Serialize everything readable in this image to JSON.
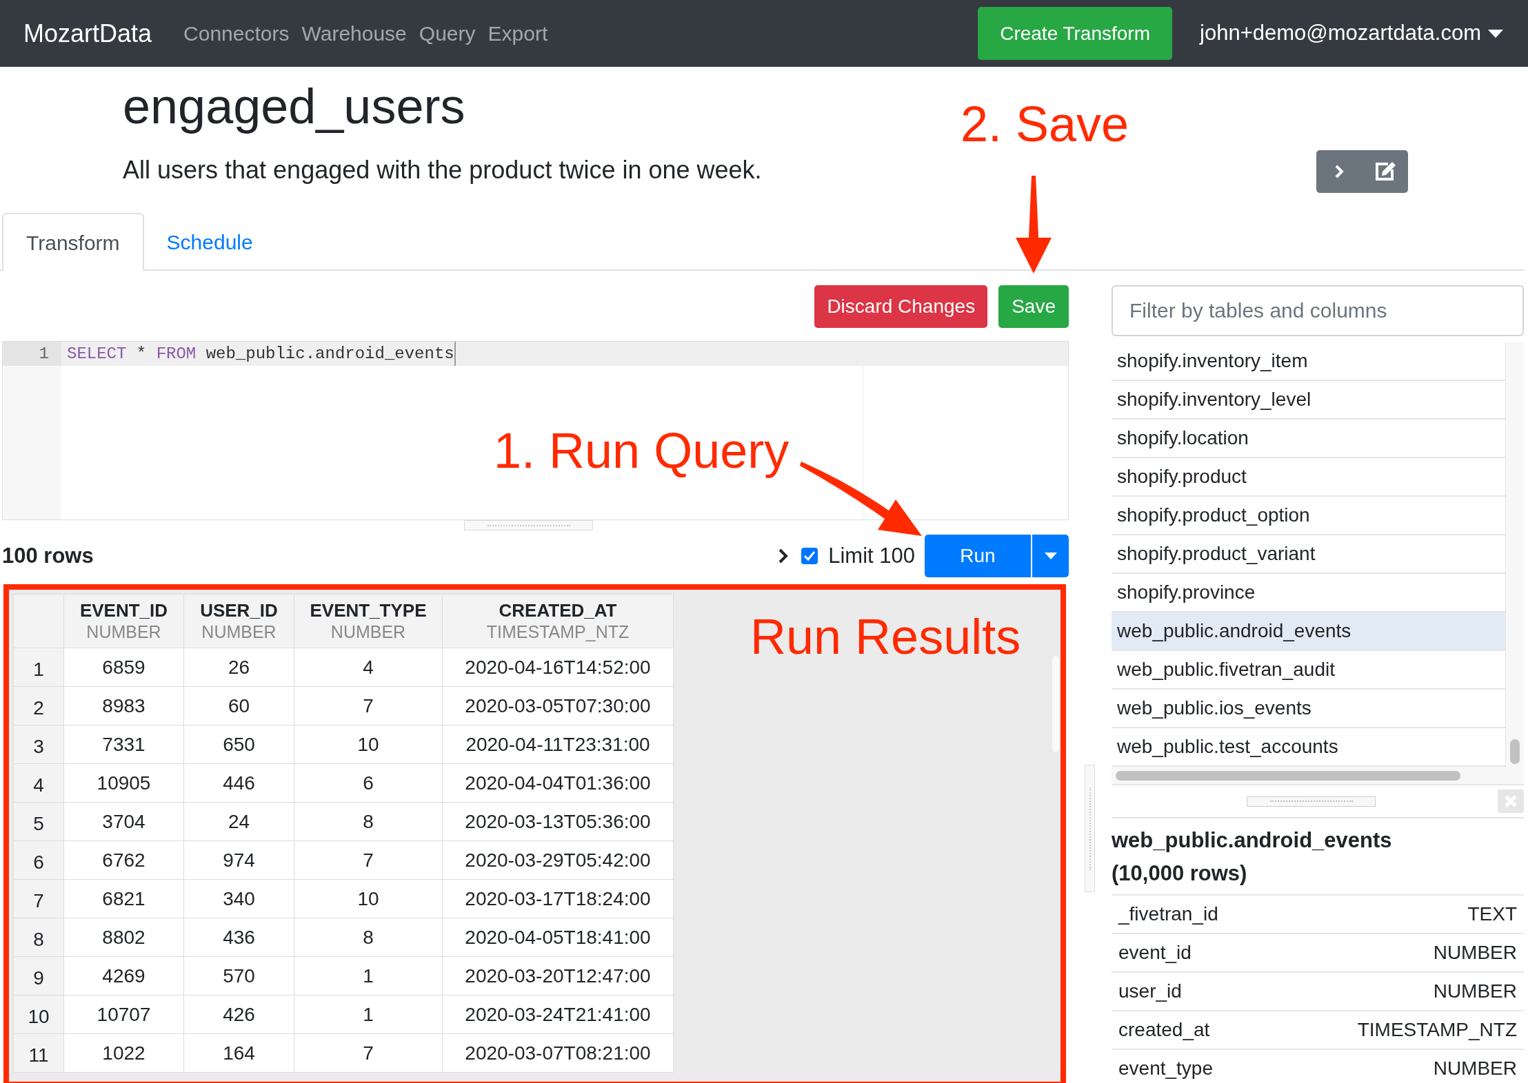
{
  "navbar": {
    "brand": "MozartData",
    "links": [
      "Connectors",
      "Warehouse",
      "Query",
      "Export"
    ],
    "create_button": "Create Transform",
    "user_menu": "john+demo@mozartdata.com"
  },
  "header": {
    "title": "engaged_users",
    "description": "All users that engaged with the product twice in one week."
  },
  "tabs": [
    {
      "label": "Transform",
      "selected": true
    },
    {
      "label": "Schedule",
      "selected": false
    }
  ],
  "actions": {
    "discard": "Discard Changes",
    "save": "Save"
  },
  "editor": {
    "lines": [
      {
        "number": "1",
        "tokens": [
          {
            "kind": "keyword",
            "text": "SELECT"
          },
          {
            "kind": "plain",
            "text": " * "
          },
          {
            "kind": "keyword",
            "text": "FROM"
          },
          {
            "kind": "plain",
            "text": " web_public.android_events"
          }
        ]
      }
    ]
  },
  "results": {
    "row_count": "100 rows",
    "limit": {
      "label": "Limit 100",
      "checked": true
    },
    "run_button": "Run"
  },
  "table": {
    "columns": [
      {
        "name": "EVENT_ID",
        "type": "NUMBER"
      },
      {
        "name": "USER_ID",
        "type": "NUMBER"
      },
      {
        "name": "EVENT_TYPE",
        "type": "NUMBER"
      },
      {
        "name": "CREATED_AT",
        "type": "TIMESTAMP_NTZ"
      }
    ],
    "rows": [
      {
        "index": "1",
        "cells": [
          "6859",
          "26",
          "4",
          "2020-04-16T14:52:00"
        ]
      },
      {
        "index": "2",
        "cells": [
          "8983",
          "60",
          "7",
          "2020-03-05T07:30:00"
        ]
      },
      {
        "index": "3",
        "cells": [
          "7331",
          "650",
          "10",
          "2020-04-11T23:31:00"
        ]
      },
      {
        "index": "4",
        "cells": [
          "10905",
          "446",
          "6",
          "2020-04-04T01:36:00"
        ]
      },
      {
        "index": "5",
        "cells": [
          "3704",
          "24",
          "8",
          "2020-03-13T05:36:00"
        ]
      },
      {
        "index": "6",
        "cells": [
          "6762",
          "974",
          "7",
          "2020-03-29T05:42:00"
        ]
      },
      {
        "index": "7",
        "cells": [
          "6821",
          "340",
          "10",
          "2020-03-17T18:24:00"
        ]
      },
      {
        "index": "8",
        "cells": [
          "8802",
          "436",
          "8",
          "2020-04-05T18:41:00"
        ]
      },
      {
        "index": "9",
        "cells": [
          "4269",
          "570",
          "1",
          "2020-03-20T12:47:00"
        ]
      },
      {
        "index": "10",
        "cells": [
          "10707",
          "426",
          "1",
          "2020-03-24T21:41:00"
        ]
      },
      {
        "index": "11",
        "cells": [
          "1022",
          "164",
          "7",
          "2020-03-07T08:21:00"
        ]
      }
    ]
  },
  "schema": {
    "filter_placeholder": "Filter by tables and columns",
    "tables": [
      {
        "name": "shopify.inventory_item",
        "selected": false
      },
      {
        "name": "shopify.inventory_level",
        "selected": false
      },
      {
        "name": "shopify.location",
        "selected": false
      },
      {
        "name": "shopify.product",
        "selected": false
      },
      {
        "name": "shopify.product_option",
        "selected": false
      },
      {
        "name": "shopify.product_variant",
        "selected": false
      },
      {
        "name": "shopify.province",
        "selected": false
      },
      {
        "name": "web_public.android_events",
        "selected": true
      },
      {
        "name": "web_public.fivetran_audit",
        "selected": false
      },
      {
        "name": "web_public.ios_events",
        "selected": false
      },
      {
        "name": "web_public.test_accounts",
        "selected": false
      }
    ],
    "details": {
      "title": "web_public.android_events",
      "row_count": "(10,000 rows)",
      "columns": [
        {
          "name": "_fivetran_id",
          "type": "TEXT"
        },
        {
          "name": "event_id",
          "type": "NUMBER"
        },
        {
          "name": "user_id",
          "type": "NUMBER"
        },
        {
          "name": "created_at",
          "type": "TIMESTAMP_NTZ"
        },
        {
          "name": "event_type",
          "type": "NUMBER"
        }
      ]
    }
  },
  "annotations": [
    "2. Save",
    "1. Run Query",
    "Run Results"
  ]
}
